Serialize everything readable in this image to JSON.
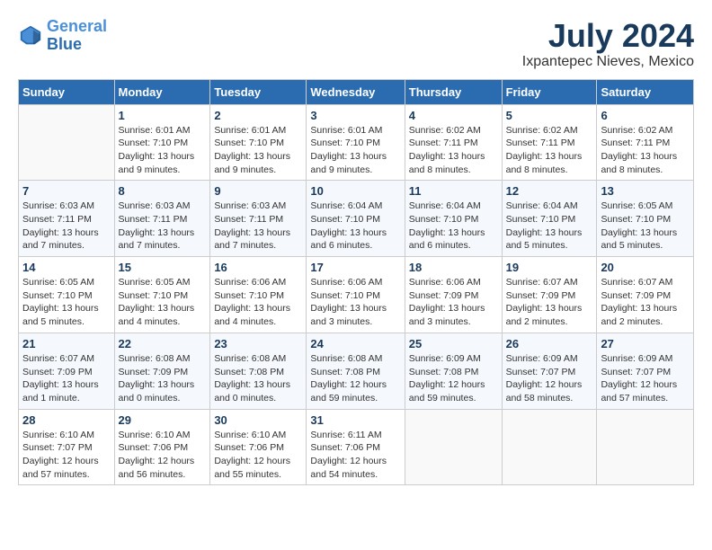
{
  "header": {
    "logo_line1": "General",
    "logo_line2": "Blue",
    "month_year": "July 2024",
    "location": "Ixpantepec Nieves, Mexico"
  },
  "calendar": {
    "days_of_week": [
      "Sunday",
      "Monday",
      "Tuesday",
      "Wednesday",
      "Thursday",
      "Friday",
      "Saturday"
    ],
    "weeks": [
      [
        {
          "day": "",
          "info": ""
        },
        {
          "day": "1",
          "info": "Sunrise: 6:01 AM\nSunset: 7:10 PM\nDaylight: 13 hours and 9 minutes."
        },
        {
          "day": "2",
          "info": "Sunrise: 6:01 AM\nSunset: 7:10 PM\nDaylight: 13 hours and 9 minutes."
        },
        {
          "day": "3",
          "info": "Sunrise: 6:01 AM\nSunset: 7:10 PM\nDaylight: 13 hours and 9 minutes."
        },
        {
          "day": "4",
          "info": "Sunrise: 6:02 AM\nSunset: 7:11 PM\nDaylight: 13 hours and 8 minutes."
        },
        {
          "day": "5",
          "info": "Sunrise: 6:02 AM\nSunset: 7:11 PM\nDaylight: 13 hours and 8 minutes."
        },
        {
          "day": "6",
          "info": "Sunrise: 6:02 AM\nSunset: 7:11 PM\nDaylight: 13 hours and 8 minutes."
        }
      ],
      [
        {
          "day": "7",
          "info": "Sunrise: 6:03 AM\nSunset: 7:11 PM\nDaylight: 13 hours and 7 minutes."
        },
        {
          "day": "8",
          "info": "Sunrise: 6:03 AM\nSunset: 7:11 PM\nDaylight: 13 hours and 7 minutes."
        },
        {
          "day": "9",
          "info": "Sunrise: 6:03 AM\nSunset: 7:11 PM\nDaylight: 13 hours and 7 minutes."
        },
        {
          "day": "10",
          "info": "Sunrise: 6:04 AM\nSunset: 7:10 PM\nDaylight: 13 hours and 6 minutes."
        },
        {
          "day": "11",
          "info": "Sunrise: 6:04 AM\nSunset: 7:10 PM\nDaylight: 13 hours and 6 minutes."
        },
        {
          "day": "12",
          "info": "Sunrise: 6:04 AM\nSunset: 7:10 PM\nDaylight: 13 hours and 5 minutes."
        },
        {
          "day": "13",
          "info": "Sunrise: 6:05 AM\nSunset: 7:10 PM\nDaylight: 13 hours and 5 minutes."
        }
      ],
      [
        {
          "day": "14",
          "info": "Sunrise: 6:05 AM\nSunset: 7:10 PM\nDaylight: 13 hours and 5 minutes."
        },
        {
          "day": "15",
          "info": "Sunrise: 6:05 AM\nSunset: 7:10 PM\nDaylight: 13 hours and 4 minutes."
        },
        {
          "day": "16",
          "info": "Sunrise: 6:06 AM\nSunset: 7:10 PM\nDaylight: 13 hours and 4 minutes."
        },
        {
          "day": "17",
          "info": "Sunrise: 6:06 AM\nSunset: 7:10 PM\nDaylight: 13 hours and 3 minutes."
        },
        {
          "day": "18",
          "info": "Sunrise: 6:06 AM\nSunset: 7:09 PM\nDaylight: 13 hours and 3 minutes."
        },
        {
          "day": "19",
          "info": "Sunrise: 6:07 AM\nSunset: 7:09 PM\nDaylight: 13 hours and 2 minutes."
        },
        {
          "day": "20",
          "info": "Sunrise: 6:07 AM\nSunset: 7:09 PM\nDaylight: 13 hours and 2 minutes."
        }
      ],
      [
        {
          "day": "21",
          "info": "Sunrise: 6:07 AM\nSunset: 7:09 PM\nDaylight: 13 hours and 1 minute."
        },
        {
          "day": "22",
          "info": "Sunrise: 6:08 AM\nSunset: 7:09 PM\nDaylight: 13 hours and 0 minutes."
        },
        {
          "day": "23",
          "info": "Sunrise: 6:08 AM\nSunset: 7:08 PM\nDaylight: 13 hours and 0 minutes."
        },
        {
          "day": "24",
          "info": "Sunrise: 6:08 AM\nSunset: 7:08 PM\nDaylight: 12 hours and 59 minutes."
        },
        {
          "day": "25",
          "info": "Sunrise: 6:09 AM\nSunset: 7:08 PM\nDaylight: 12 hours and 59 minutes."
        },
        {
          "day": "26",
          "info": "Sunrise: 6:09 AM\nSunset: 7:07 PM\nDaylight: 12 hours and 58 minutes."
        },
        {
          "day": "27",
          "info": "Sunrise: 6:09 AM\nSunset: 7:07 PM\nDaylight: 12 hours and 57 minutes."
        }
      ],
      [
        {
          "day": "28",
          "info": "Sunrise: 6:10 AM\nSunset: 7:07 PM\nDaylight: 12 hours and 57 minutes."
        },
        {
          "day": "29",
          "info": "Sunrise: 6:10 AM\nSunset: 7:06 PM\nDaylight: 12 hours and 56 minutes."
        },
        {
          "day": "30",
          "info": "Sunrise: 6:10 AM\nSunset: 7:06 PM\nDaylight: 12 hours and 55 minutes."
        },
        {
          "day": "31",
          "info": "Sunrise: 6:11 AM\nSunset: 7:06 PM\nDaylight: 12 hours and 54 minutes."
        },
        {
          "day": "",
          "info": ""
        },
        {
          "day": "",
          "info": ""
        },
        {
          "day": "",
          "info": ""
        }
      ]
    ]
  }
}
